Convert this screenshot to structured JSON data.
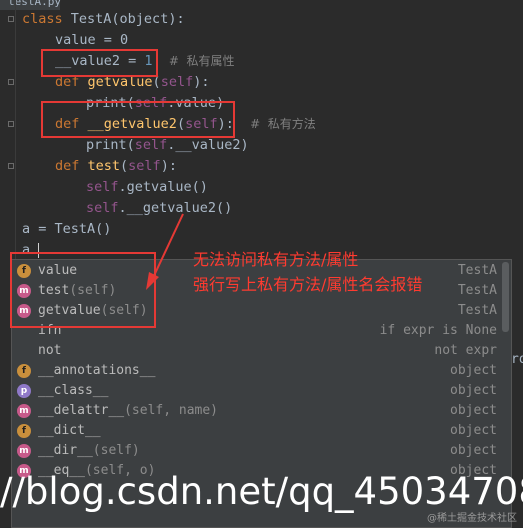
{
  "tab": {
    "label": "testA.py"
  },
  "code": {
    "class_kw": "class",
    "class_name": " TestA",
    "class_rest": "(object):",
    "value_line": "value = 0",
    "value2_name": "__value2",
    "value2_eq": " = ",
    "value2_num": "1",
    "value2_comment": "#  私有属性",
    "def1_kw": "def",
    "def1_name": " getvalue",
    "def1_open": "(",
    "def1_self": "self",
    "def1_close": "):",
    "print1_a": "print(",
    "print1_self": "self",
    "print1_b": ".value)",
    "def2_kw": "def",
    "def2_name": " __getvalue2",
    "def2_open": "(",
    "def2_self": "self",
    "def2_close": "):",
    "def2_comment": "#  私有方法",
    "print2_a": "print(",
    "print2_self": "self",
    "print2_b": ".__value2)",
    "def3_kw": "def",
    "def3_name": " test",
    "def3_open": "(",
    "def3_self": "self",
    "def3_close": "):",
    "call1_self": "self",
    "call1_b": ".getvalue()",
    "call2_self": "self",
    "call2_b": ".__getvalue2()",
    "assign_line": "a = TestA()",
    "typing_line": "a."
  },
  "annotation": {
    "line1": "无法访问私有方法/属性",
    "line2": "强行写上私有方法/属性名会报错"
  },
  "completions": [
    {
      "icon": "f",
      "name": "value",
      "params": "",
      "type": "TestA"
    },
    {
      "icon": "m",
      "name": "test",
      "params": "(self)",
      "type": "TestA"
    },
    {
      "icon": "m",
      "name": "getvalue",
      "params": "(self)",
      "type": "TestA"
    },
    {
      "icon": "",
      "name": "ifn",
      "params": "",
      "type": "if expr is None"
    },
    {
      "icon": "",
      "name": "not",
      "params": "",
      "type": "not expr"
    },
    {
      "icon": "f",
      "name": "__annotations__",
      "params": "",
      "type": "object"
    },
    {
      "icon": "p",
      "name": "__class__",
      "params": "",
      "type": "object"
    },
    {
      "icon": "m",
      "name": "__delattr__",
      "params": "(self, name)",
      "type": "object"
    },
    {
      "icon": "f",
      "name": "__dict__",
      "params": "",
      "type": "object"
    },
    {
      "icon": "m",
      "name": "__dir__",
      "params": "(self)",
      "type": "object"
    },
    {
      "icon": "m",
      "name": "__eq__",
      "params": "(self, o)",
      "type": "object"
    }
  ],
  "side_fragment": "ro",
  "watermark": {
    "url": "//blog.csdn.net/qq_45034708",
    "small": "@稀土掘金技术社区"
  }
}
